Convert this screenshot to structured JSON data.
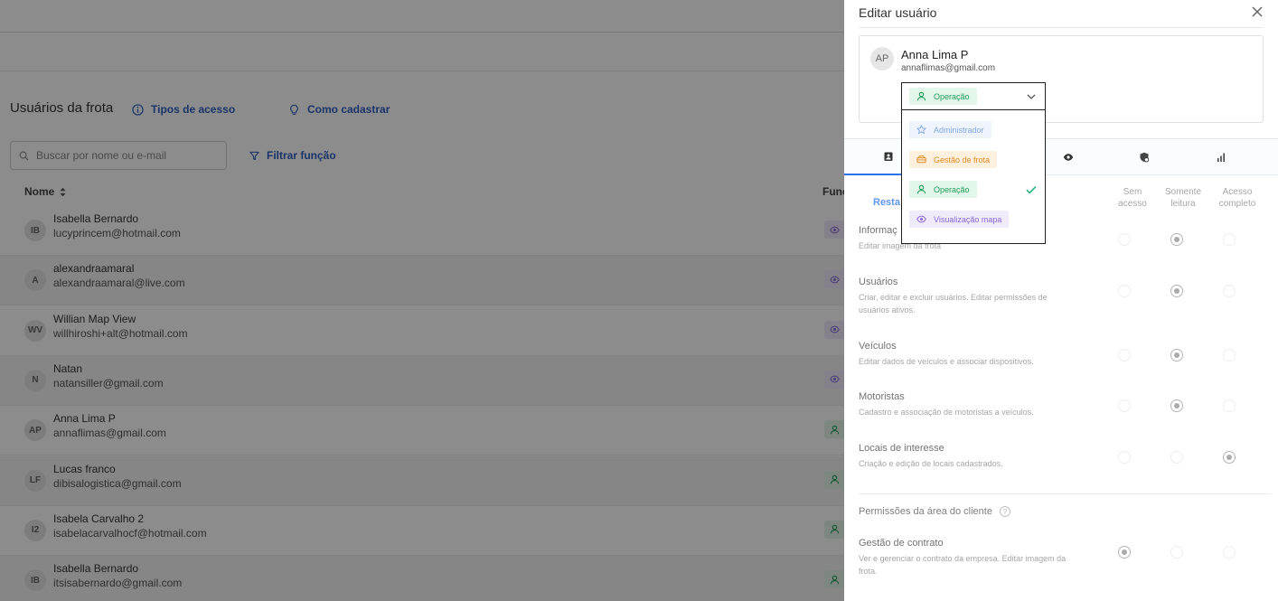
{
  "background": {
    "page_title": "Usuários da frota",
    "links": {
      "access_types": "Tipos de acesso",
      "how_to_register": "Como cadastrar"
    },
    "search": {
      "placeholder": "Buscar por nome ou e-mail"
    },
    "filter": {
      "label": "Filtrar função"
    },
    "columns": {
      "name": "Nome",
      "function": "Funç"
    },
    "rows": [
      {
        "initials": "IB",
        "name": "Isabella Bernardo",
        "email": "lucyprincem@hotmail.com",
        "role": "visualizacao"
      },
      {
        "initials": "A",
        "name": "alexandraamaral",
        "email": "alexandraamaral@live.com",
        "role": "visualizacao"
      },
      {
        "initials": "WV",
        "name": "Willian Map View",
        "email": "willhiroshi+alt@hotmail.com",
        "role": "visualizacao"
      },
      {
        "initials": "N",
        "name": "Natan",
        "email": "natansiller@gmail.com",
        "role": "visualizacao"
      },
      {
        "initials": "AP",
        "name": "Anna Lima P",
        "email": "annaflimas@gmail.com",
        "role": "operacao"
      },
      {
        "initials": "LF",
        "name": "Lucas franco",
        "email": "dibisalogistica@gmail.com",
        "role": "operacao"
      },
      {
        "initials": "I2",
        "name": "Isabela Carvalho 2",
        "email": "isabelacarvalhocf@hotmail.com",
        "role": "operacao"
      },
      {
        "initials": "IB",
        "name": "Isabella Bernardo",
        "email": "itsisabernardo@gmail.com",
        "role": "operacao"
      }
    ]
  },
  "panel": {
    "title": "Editar usuário",
    "user": {
      "initials": "AP",
      "name": "Anna Lima P",
      "email": "annaflimas@gmail.com"
    },
    "selected_role": "Operação",
    "tabs": [
      "user-card-icon",
      "truck-icon",
      "steering-icon",
      "eye-icon",
      "shield-icon",
      "bar-chart-icon"
    ],
    "restore_label": "Resta",
    "perm_columns": [
      {
        "line1": "Sem",
        "line2": "acesso"
      },
      {
        "line1": "Somente",
        "line2": "leitura"
      },
      {
        "line1": "Acesso",
        "line2": "completo"
      }
    ],
    "permissions": [
      {
        "title": "Informaç",
        "desc": "Editar imagem da frota",
        "level": 1
      },
      {
        "title": "Usuários",
        "desc": "Criar, editar e excluir usuários. Editar permissões de usuários ativos.",
        "level": 1
      },
      {
        "title": "Veículos",
        "desc": "Editar dados de veículos e associar dispositivos.",
        "level": 1
      },
      {
        "title": "Motoristas",
        "desc": "Cadastro e associação de motoristas a veículos.",
        "level": 1
      },
      {
        "title": "Locais de interesse",
        "desc": "Criação e edição de locais cadastrados.",
        "level": 2
      }
    ],
    "client_section": {
      "title": "Permissões da área do cliente",
      "help": "?",
      "items": [
        {
          "title": "Gestão de contrato",
          "desc": "Ver e gerenciar o contrato da empresa. Editar imagem da frota.",
          "level": 0
        }
      ]
    }
  },
  "dropdown": {
    "options": [
      {
        "label": "Administrador",
        "icon": "star-icon",
        "color": "#7fa8e6",
        "bg": "#eef3fc",
        "selected": false
      },
      {
        "label": "Gestão de frota",
        "icon": "car-icon",
        "color": "#e08a1e",
        "bg": "#fdf0de",
        "selected": false
      },
      {
        "label": "Operação",
        "icon": "person-icon",
        "color": "#1e9e57",
        "bg": "#e3f6ea",
        "selected": true
      },
      {
        "label": "Visualização mapa",
        "icon": "eye-icon",
        "color": "#8a66d6",
        "bg": "#f0ebfb",
        "selected": false
      }
    ]
  },
  "colors": {
    "accent": "#2a73e8",
    "link": "#2f5fbf",
    "operacao": "#1e9e57",
    "visualizacao": "#8a66d6",
    "check": "#1fb47a"
  }
}
